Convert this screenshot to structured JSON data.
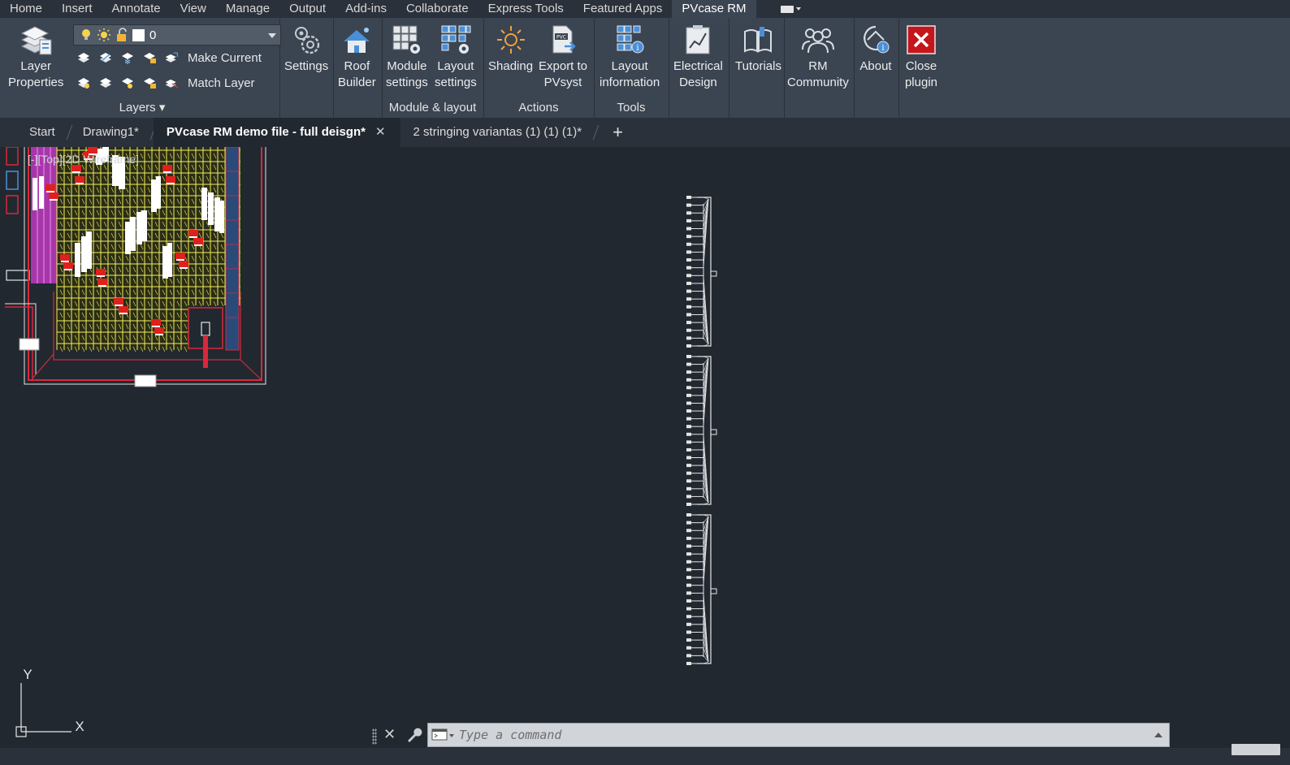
{
  "menu": {
    "tabs": [
      "Home",
      "Insert",
      "Annotate",
      "View",
      "Manage",
      "Output",
      "Add-ins",
      "Collaborate",
      "Express Tools",
      "Featured Apps",
      "PVcase RM"
    ],
    "active_index": 10
  },
  "ribbon": {
    "layers": {
      "layer_properties_label": "Layer\nProperties",
      "current_layer": "0",
      "make_current_label": "Make Current",
      "match_layer_label": "Match Layer",
      "panel_title": "Layers ▾"
    },
    "settings": {
      "settings_label": "Settings"
    },
    "roof": {
      "roof_builder_label": "Roof\nBuilder"
    },
    "module_layout": {
      "module_settings_label": "Module\nsettings",
      "layout_settings_label": "Layout\nsettings",
      "panel_title": "Module & layout"
    },
    "actions": {
      "shading_label": "Shading",
      "export_label": "Export to\nPVsyst",
      "panel_title": "Actions"
    },
    "tools": {
      "layout_info_label": "Layout\ninformation",
      "panel_title": "Tools"
    },
    "electrical": {
      "electrical_design_label": "Electrical\nDesign"
    },
    "tutorials": {
      "tutorials_label": "Tutorials"
    },
    "community": {
      "rm_community_label": "RM\nCommunity"
    },
    "about": {
      "about_label": "About"
    },
    "close": {
      "close_plugin_label": "Close\nplugin"
    }
  },
  "doc_tabs": {
    "tabs": [
      {
        "label": "Start"
      },
      {
        "label": "Drawing1*"
      },
      {
        "label": "PVcase RM demo file - full deisgn*",
        "closable": true
      },
      {
        "label": "2 stringing variantas (1) (1) (1)*"
      }
    ],
    "active_index": 2,
    "new_tab_symbol": "+"
  },
  "viewport": {
    "label": "[-][Top][2D Wireframe]"
  },
  "ucs": {
    "y_label": "Y",
    "x_label": "X"
  },
  "command_line": {
    "placeholder": "Type a command"
  },
  "colors": {
    "canvas_bg": "#212830",
    "ribbon_bg": "#3b4451",
    "pv_modules": "#f4ef5a",
    "magenta_zone": "#d53bd4",
    "boundary_red": "#d9283b",
    "close_red": "#c4161c"
  }
}
